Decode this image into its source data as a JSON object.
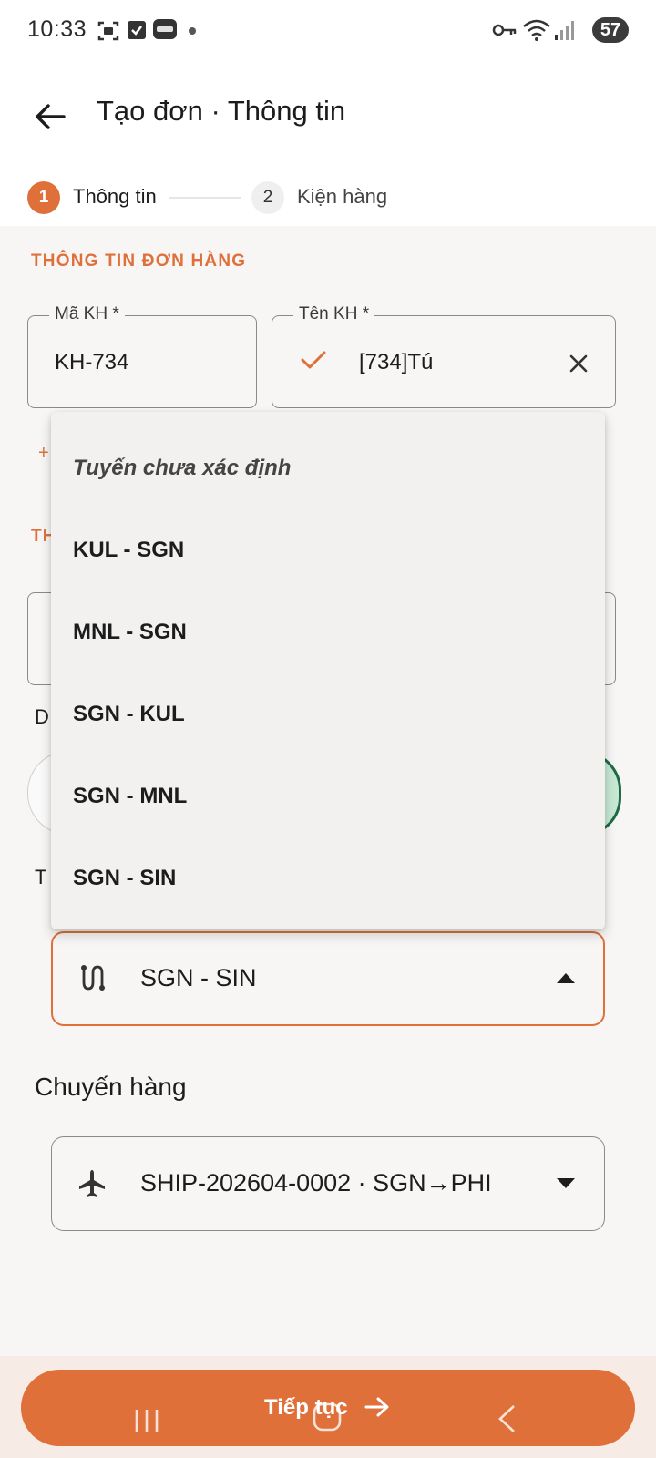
{
  "status_bar": {
    "time": "10:33",
    "battery": "57",
    "icons": [
      "screenshot-icon",
      "check-box-icon",
      "zalo-icon",
      "dot-icon",
      "vpn-key-icon",
      "wifi-icon",
      "signal-icon",
      "battery-icon"
    ]
  },
  "header": {
    "title": "Tạo đơn · Thông tin"
  },
  "stepper": {
    "steps": [
      {
        "number": "1",
        "label": "Thông tin",
        "active": true
      },
      {
        "number": "2",
        "label": "Kiện hàng",
        "active": false
      }
    ]
  },
  "order_info": {
    "section_title": "THÔNG TIN ĐƠN HÀNG",
    "customer_code": {
      "label": "Mã KH *",
      "value": "KH-734"
    },
    "customer_name": {
      "label": "Tên KH *",
      "value": "[734]Tú"
    }
  },
  "partially_hidden": {
    "add_prefix": "+",
    "section2_prefix": "TH",
    "label_d_prefix": "D",
    "label_t_prefix": "T"
  },
  "route_menu": {
    "options": [
      "Tuyến chưa xác định",
      "KUL - SGN",
      "MNL - SGN",
      "SGN - KUL",
      "SGN - MNL",
      "SGN - SIN"
    ]
  },
  "route": {
    "value": "SGN - SIN"
  },
  "shipment": {
    "label": "Chuyến hàng",
    "value": "SHIP-202604-0002 · SGN→PHI"
  },
  "footer": {
    "continue_label": "Tiếp tục"
  },
  "colors": {
    "accent": "#e0703a",
    "background": "#f7f6f5",
    "selected_green_border": "#1f6b45",
    "selected_green_fill": "#c8e8d5"
  }
}
